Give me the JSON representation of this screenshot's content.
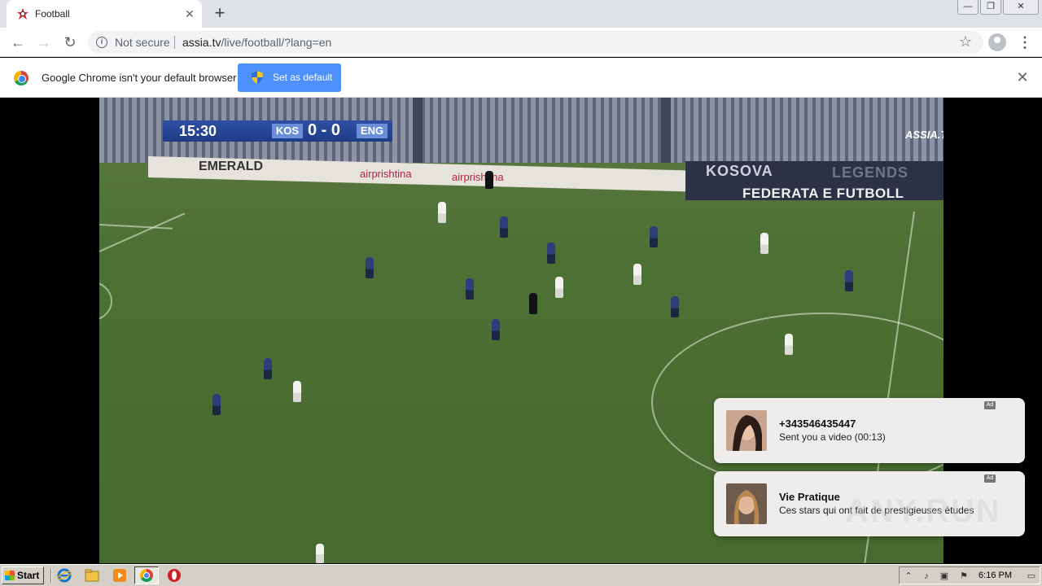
{
  "browser": {
    "tab": {
      "title": "Football",
      "close": "✕"
    },
    "new_tab": "+",
    "window_controls": [
      "—",
      "❐",
      "✕"
    ],
    "address": {
      "security": "Not secure",
      "host": "assia.tv",
      "path": "/live/football/?lang=en"
    },
    "nav": {
      "back": "←",
      "forward": "→",
      "reload": "↻",
      "star": "☆",
      "menu": "⋮"
    }
  },
  "infobar": {
    "message": "Google Chrome isn't your default browser",
    "button_label": "Set as default",
    "close": "✕"
  },
  "video": {
    "scorebug": {
      "time": "15:30",
      "home": "KOS",
      "score": "0 - 0",
      "away": "ENG"
    },
    "logo_text": "ASSIA.TV",
    "boards": {
      "emerald": "EMERALD",
      "airprishtina1": "airprishtina",
      "airprishtina2": "airprishtina",
      "kosova": "KOSOVA",
      "legends": "LEGENDS",
      "federata": "FEDERATA E FUTBOLL"
    }
  },
  "notifications": [
    {
      "badge": "Ad",
      "title": "+343546435447",
      "body": "Sent you a video (00:13)"
    },
    {
      "badge": "Ad",
      "title": "Vie Pratique",
      "body": "Ces stars qui ont fait de prestigieuses études"
    }
  ],
  "watermark": "ANY.RUN",
  "taskbar": {
    "start_label": "Start",
    "clock": "6:16 PM"
  },
  "colors": {
    "chrome_blue": "#4d90fe",
    "pitch_green": "#4e7136",
    "scorebug_blue": "#2d4fa3"
  }
}
